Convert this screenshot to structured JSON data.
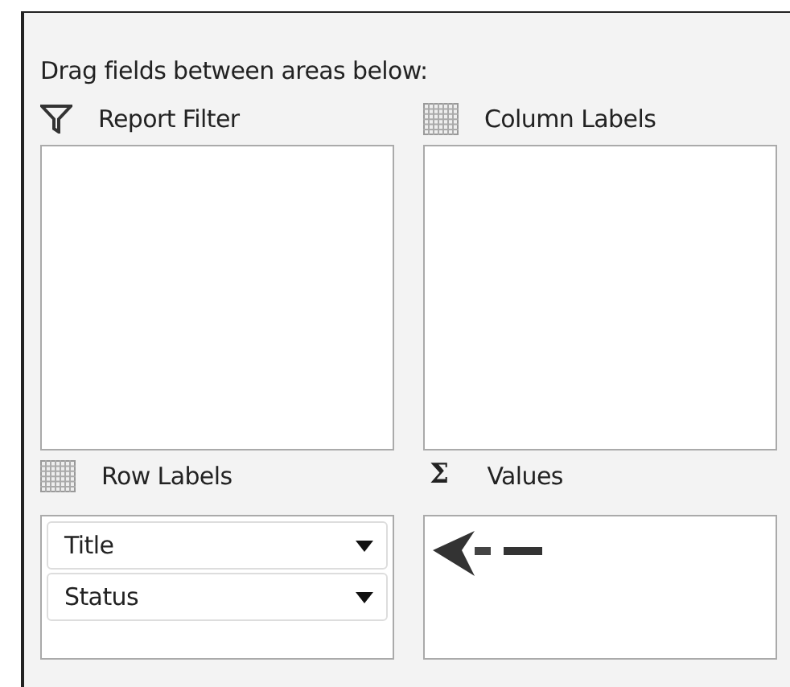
{
  "instruction": "Drag fields between areas below:",
  "areas": [
    {
      "label": "Report Filter",
      "kind": "filter"
    },
    {
      "label": "Column Labels",
      "kind": "grid"
    },
    {
      "label": "Row Labels",
      "kind": "grid",
      "fields": [
        {
          "label": "Title"
        },
        {
          "label": "Status"
        }
      ]
    },
    {
      "label": "Values",
      "kind": "sigma",
      "glyph": "Σ",
      "drop_target": true
    }
  ]
}
